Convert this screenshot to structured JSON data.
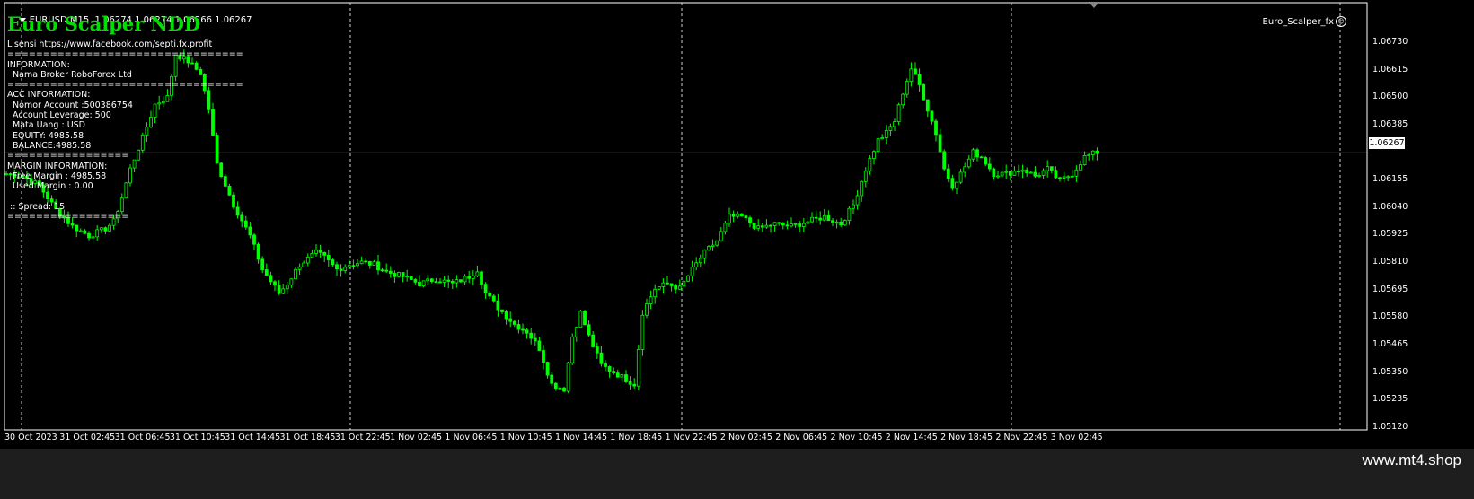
{
  "header": {
    "symbol_info": "EURUSD,M15  1.06274 1.06274 1.06266 1.06267",
    "ea_title": "Euro Scalper NDD",
    "ea_name": "Euro_Scalper_fx"
  },
  "info_panel": [
    "Lisensi https://www.facebook.com/septi.fx.profit",
    "=================================",
    "INFORMATION:",
    "  Nama Broker RoboForex Ltd",
    "=================================",
    "ACC INFORMATION:",
    "  Nomor Account :500386754",
    "  Account Leverage: 500",
    "  Mata Uang : USD",
    "  EQUITY: 4985.58",
    "  BALANCE:4985.58",
    "=================",
    "MARGIN INFORMATION:",
    "  Free Margin : 4985.58",
    "  Used Margin : 0.00",
    "",
    " :: Spread: 15",
    "================="
  ],
  "watermark": "www.mt4.shop",
  "colors": {
    "candle": "#00ff00",
    "background": "#000000",
    "grid": "#c8c8c8",
    "title": "#00e000"
  },
  "chart_data": {
    "type": "candlestick",
    "symbol": "EURUSD",
    "timeframe": "M15",
    "current_price": "1.06267",
    "y_ticks": [
      "1.06730",
      "1.06615",
      "1.06500",
      "1.06385",
      "1.06267",
      "1.06155",
      "1.06040",
      "1.05925",
      "1.05810",
      "1.05695",
      "1.05580",
      "1.05465",
      "1.05350",
      "1.05235",
      "1.05120"
    ],
    "x_ticks": [
      "30 Oct 2023",
      "31 Oct 02:45",
      "31 Oct 06:45",
      "31 Oct 10:45",
      "31 Oct 14:45",
      "31 Oct 18:45",
      "31 Oct 22:45",
      "1 Nov 02:45",
      "1 Nov 06:45",
      "1 Nov 10:45",
      "1 Nov 14:45",
      "1 Nov 18:45",
      "1 Nov 22:45",
      "2 Nov 02:45",
      "2 Nov 06:45",
      "2 Nov 10:45",
      "2 Nov 14:45",
      "2 Nov 18:45",
      "2 Nov 22:45",
      "3 Nov 02:45"
    ],
    "ylim": [
      1.0512,
      1.0679
    ],
    "day_separators": [
      "31 Oct",
      "1 Nov",
      "2 Nov",
      "3 Nov"
    ],
    "price_path": [
      [
        0,
        1.0618
      ],
      [
        4,
        1.0617
      ],
      [
        8,
        1.0613
      ],
      [
        12,
        1.0603
      ],
      [
        16,
        1.0596
      ],
      [
        20,
        1.0592
      ],
      [
        24,
        1.0595
      ],
      [
        26,
        1.0598
      ],
      [
        28,
        1.0608
      ],
      [
        30,
        1.062
      ],
      [
        33,
        1.0633
      ],
      [
        36,
        1.0647
      ],
      [
        39,
        1.065
      ],
      [
        41,
        1.0668
      ],
      [
        44,
        1.0665
      ],
      [
        47,
        1.066
      ],
      [
        49,
        1.0645
      ],
      [
        51,
        1.0622
      ],
      [
        55,
        1.0605
      ],
      [
        59,
        1.0592
      ],
      [
        62,
        1.0578
      ],
      [
        66,
        1.0568
      ],
      [
        68,
        1.0572
      ],
      [
        71,
        1.058
      ],
      [
        75,
        1.0585
      ],
      [
        77,
        1.0583
      ],
      [
        80,
        1.0578
      ],
      [
        83,
        1.058
      ],
      [
        86,
        1.0581
      ],
      [
        89,
        1.058
      ],
      [
        92,
        1.0577
      ],
      [
        96,
        1.0575
      ],
      [
        100,
        1.0572
      ],
      [
        104,
        1.0574
      ],
      [
        108,
        1.0572
      ],
      [
        112,
        1.0575
      ],
      [
        114,
        1.0578
      ],
      [
        116,
        1.0568
      ],
      [
        119,
        1.0562
      ],
      [
        123,
        1.0555
      ],
      [
        126,
        1.0552
      ],
      [
        129,
        1.0545
      ],
      [
        132,
        1.053
      ],
      [
        135,
        1.0528
      ],
      [
        137,
        1.055
      ],
      [
        139,
        1.056
      ],
      [
        141,
        1.055
      ],
      [
        144,
        1.0538
      ],
      [
        147,
        1.0535
      ],
      [
        150,
        1.0532
      ],
      [
        152,
        1.053
      ],
      [
        154,
        1.056
      ],
      [
        157,
        1.057
      ],
      [
        160,
        1.0572
      ],
      [
        163,
        1.057
      ],
      [
        166,
        1.0578
      ],
      [
        169,
        1.0585
      ],
      [
        172,
        1.059
      ],
      [
        175,
        1.06
      ],
      [
        178,
        1.06
      ],
      [
        182,
        1.0595
      ],
      [
        186,
        1.0597
      ],
      [
        190,
        1.0596
      ],
      [
        194,
        1.0598
      ],
      [
        198,
        1.06
      ],
      [
        202,
        1.0597
      ],
      [
        205,
        1.0605
      ],
      [
        208,
        1.062
      ],
      [
        211,
        1.0632
      ],
      [
        213,
        1.0635
      ],
      [
        215,
        1.064
      ],
      [
        217,
        1.0652
      ],
      [
        219,
        1.0662
      ],
      [
        221,
        1.0655
      ],
      [
        223,
        1.0645
      ],
      [
        225,
        1.0635
      ],
      [
        227,
        1.062
      ],
      [
        229,
        1.0613
      ],
      [
        231,
        1.0618
      ],
      [
        234,
        1.0627
      ],
      [
        236,
        1.0625
      ],
      [
        239,
        1.0618
      ],
      [
        242,
        1.0618
      ],
      [
        246,
        1.062
      ],
      [
        249,
        1.0617
      ],
      [
        252,
        1.062
      ],
      [
        255,
        1.0615
      ],
      [
        258,
        1.0618
      ],
      [
        261,
        1.0625
      ],
      [
        264,
        1.0627
      ]
    ]
  }
}
